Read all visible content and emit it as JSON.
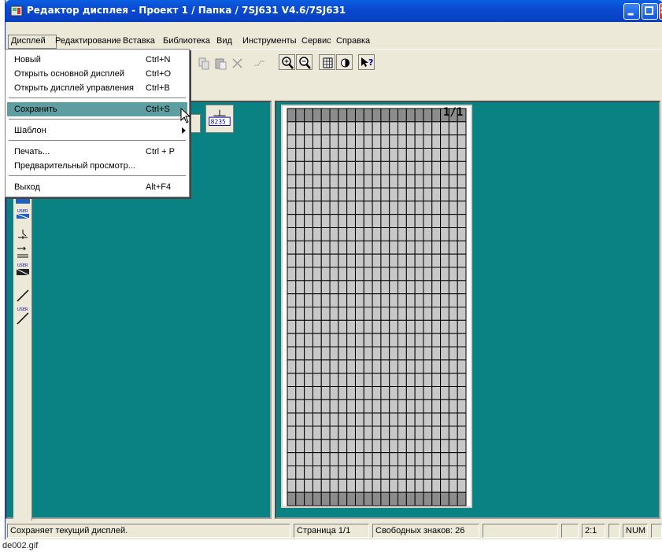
{
  "window": {
    "title": "Редактор дисплея - Проект 1 / Папка / 7SJ631 V4.6/7SJ631"
  },
  "menu": {
    "items": [
      "Дисплей",
      "Редактирование",
      "Вставка",
      "Библиотека",
      "Вид",
      "Инструменты",
      "Сервис",
      "Справка"
    ]
  },
  "dropdown": {
    "new": {
      "label": "Новый",
      "shortcut": "Ctrl+N"
    },
    "open_main": {
      "label": "Открыть основной дисплей",
      "shortcut": "Ctrl+O"
    },
    "open_control": {
      "label": "Открыть дисплей управления",
      "shortcut": "Ctrl+B"
    },
    "save": {
      "label": "Сохранить",
      "shortcut": "Ctrl+S"
    },
    "template": {
      "label": "Шаблон"
    },
    "print": {
      "label": "Печать...",
      "shortcut": "Ctrl + P"
    },
    "preview": {
      "label": "Предварительный просмотр..."
    },
    "exit": {
      "label": "Выход",
      "shortcut": "Alt+F4"
    }
  },
  "toolbar": {
    "widget_value": "8235"
  },
  "palette": {
    "user_label": "USER"
  },
  "grid": {
    "page": "1/1",
    "columns": 21,
    "rows": 30
  },
  "status": {
    "message": "Сохраняет текущий дисплей.",
    "page": "Страница 1/1",
    "free_chars": "Свободных знаков: 26",
    "zoom": "2:1",
    "num": "NUM"
  },
  "caption": "de002.gif",
  "colors": {
    "title_bar": "#0a5fe0",
    "workspace": "#0a8284",
    "highlight": "#5f9ea0",
    "face": "#ece9d8"
  }
}
